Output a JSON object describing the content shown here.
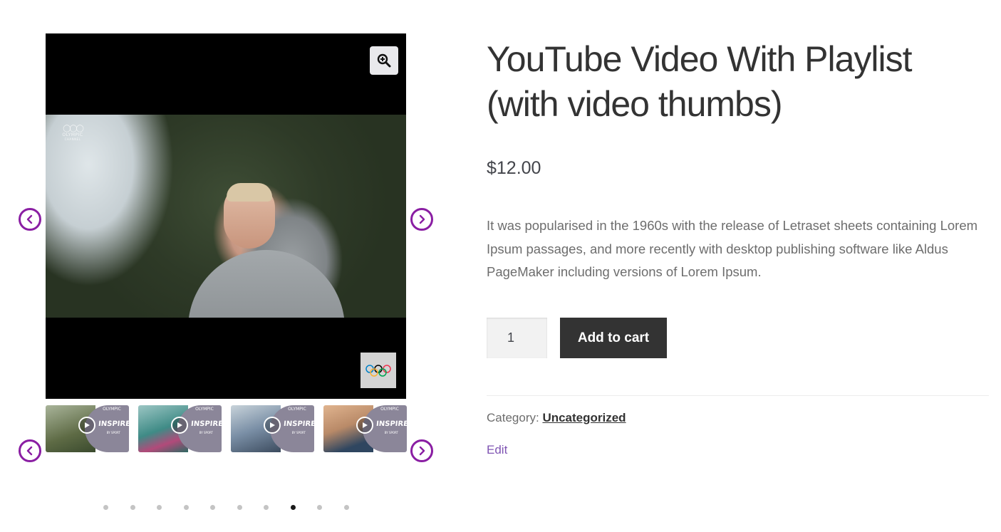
{
  "product": {
    "title": "YouTube Video With Playlist (with video thumbs)",
    "price": "$12.00",
    "description": "It was popularised in the 1960s with the release of Letraset sheets containing Lorem Ipsum passages, and more recently with desktop publishing software like Aldus PageMaker including versions of Lorem Ipsum.",
    "quantity": "1",
    "add_to_cart_label": "Add to cart",
    "category_label": "Category:",
    "category_value": "Uncategorized",
    "edit_label": "Edit"
  },
  "gallery": {
    "channel_logo_text": "OLYMPIC",
    "channel_logo_sub": "CHANNEL",
    "thumbnails": [
      {
        "brand": "INSPIRED",
        "sub": "BY SPORT",
        "rings": "OLYMPIC",
        "photo_color": "#6f7d54"
      },
      {
        "brand": "INSPIRED",
        "sub": "BY SPORT",
        "rings": "OLYMPIC",
        "photo_color": "#4f8a86"
      },
      {
        "brand": "INSPIRED",
        "sub": "BY SPORT",
        "rings": "OLYMPIC",
        "photo_color": "#7a8fa6"
      },
      {
        "brand": "INSPIRED",
        "sub": "BY SPORT",
        "rings": "OLYMPIC",
        "photo_color": "#b98a68"
      }
    ],
    "dots_count": 10,
    "active_dot_index": 7
  },
  "colors": {
    "arrow_accent": "#8a1ea3",
    "button_bg": "#333333",
    "edit_link": "#7f54b3"
  },
  "icons": {
    "zoom": "magnifier-plus-icon",
    "prev": "chevron-left-icon",
    "next": "chevron-right-icon",
    "play": "play-icon",
    "olympic": "olympic-rings-icon"
  }
}
